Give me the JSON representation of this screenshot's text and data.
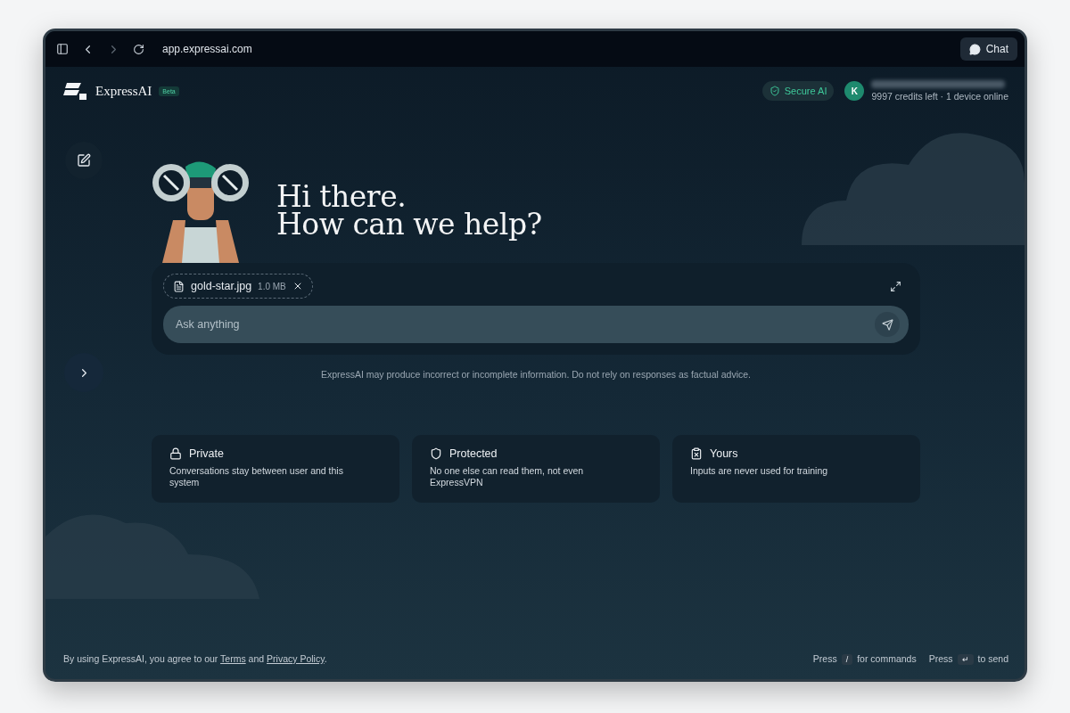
{
  "browser": {
    "url": "app.expressai.com",
    "chat_button": "Chat"
  },
  "header": {
    "brand": "ExpressAI",
    "badge": "Beta",
    "secure": "Secure AI",
    "avatar": "K",
    "credits": "9997 credits left · 1 device online"
  },
  "hero": {
    "lines": [
      "Hi there.",
      "How can we help?"
    ]
  },
  "composer": {
    "attachment": {
      "name": "gold-star.jpg",
      "size": "1.0 MB"
    },
    "placeholder": "Ask anything"
  },
  "disclaimer": "ExpressAI may produce incorrect or incomplete information. Do not rely on responses as factual advice.",
  "cards": [
    {
      "title": "Private",
      "text": "Conversations stay between user and this system"
    },
    {
      "title": "Protected",
      "text": "No one else can read them, not even ExpressVPN"
    },
    {
      "title": "Yours",
      "text": "Inputs are never used for training"
    }
  ],
  "footer": {
    "legal": {
      "prefix": "By using ExpressAI, you agree to our",
      "terms": "Terms",
      "middle": "and",
      "privacy": "Privacy Policy",
      "suffix": "."
    },
    "shortcuts": [
      {
        "before": "Press",
        "key": "/",
        "after": "for commands"
      },
      {
        "before": "Press",
        "key": "↵",
        "after": "to send"
      }
    ]
  }
}
